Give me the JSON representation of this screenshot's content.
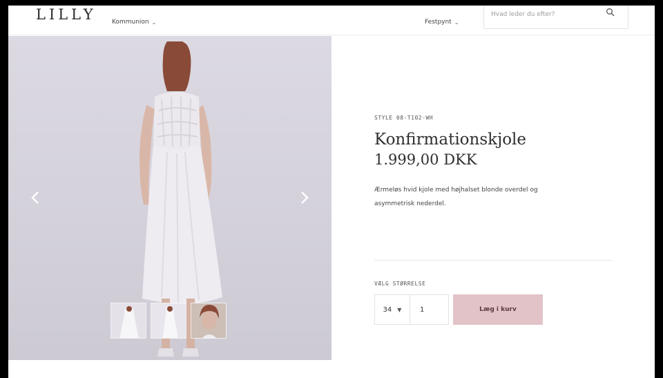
{
  "header": {
    "logo": "LILLY",
    "nav": [
      {
        "label": "Kommunion"
      },
      {
        "label": "Festpynt"
      }
    ],
    "search": {
      "placeholder": "Hvad leder du efter?"
    }
  },
  "gallery": {
    "thumbnails": [
      "thumbnail-front-view",
      "thumbnail-side-view",
      "thumbnail-detail-view"
    ]
  },
  "product": {
    "style_code": "STYLE 08-T102-WH",
    "title": "Konfirmationskjole",
    "price": "1.999,00 DKK",
    "description": "Ærmeløs hvid kjole med højhalset blonde overdel og asymmetrisk nederdel.",
    "size_label": "VÆLG STØRRELSE",
    "size_value": "34",
    "quantity": "1",
    "add_to_cart_label": "Læg i kurv"
  },
  "colors": {
    "accent_button": "#e2c3c8",
    "background_gallery": "#d4d1db"
  }
}
